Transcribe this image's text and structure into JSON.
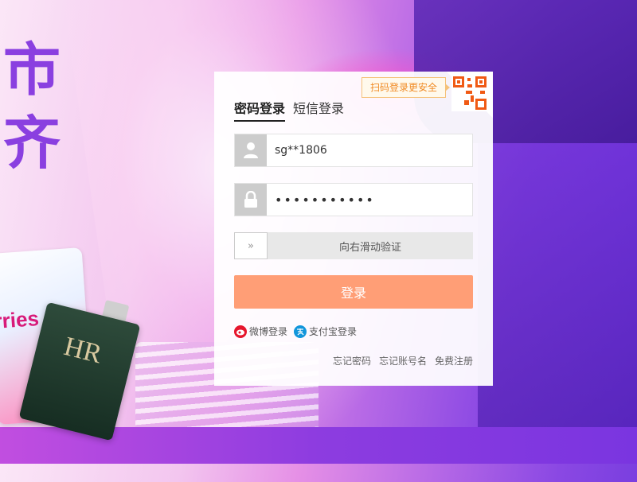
{
  "banner": {
    "line1": "市",
    "line2": "齐"
  },
  "products": {
    "diaper_brand": "rries",
    "bottle_monogram": "HR"
  },
  "qr_login": {
    "tip": "扫码登录更安全"
  },
  "tabs": [
    {
      "label": "密码登录",
      "active": true
    },
    {
      "label": "短信登录",
      "active": false
    }
  ],
  "username": {
    "value": "sg**1806"
  },
  "password": {
    "value": "•••••••••••"
  },
  "slider": {
    "handle": "»",
    "text": "向右滑动验证"
  },
  "login_button": {
    "label": "登录"
  },
  "third_party": {
    "weibo": "微博登录",
    "alipay": "支付宝登录"
  },
  "links": {
    "forgot_password": "忘记密码",
    "forgot_account": "忘记账号名",
    "register": "免费注册"
  },
  "colors": {
    "login_button": "#ff9e76",
    "qr_tip_text": "#f08a24",
    "weibo": "#e6162d",
    "alipay": "#1296db"
  }
}
